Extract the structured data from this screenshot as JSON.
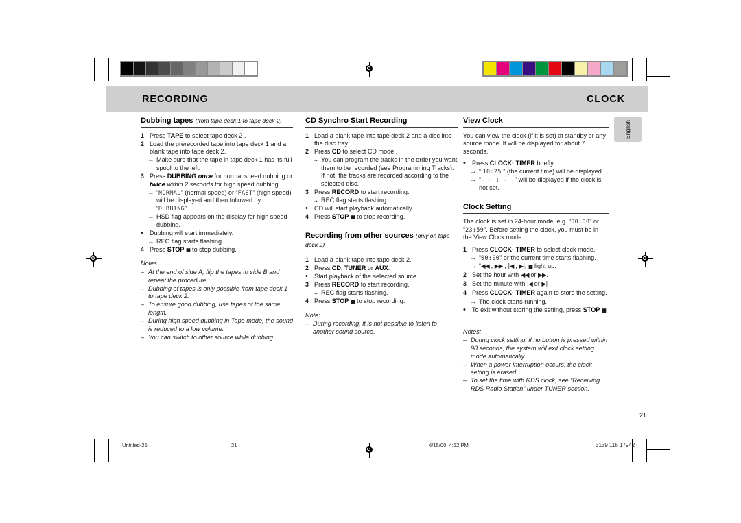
{
  "header": {
    "chapter_left": "RECORDING",
    "chapter_right": "CLOCK"
  },
  "language_tab": {
    "label": "English"
  },
  "calibration": {
    "grayscale": [
      "#000000",
      "#151515",
      "#333333",
      "#4c4c4c",
      "#666666",
      "#808080",
      "#999999",
      "#b3b3b3",
      "#cccccc",
      "#f0f0f0",
      "#ffffff"
    ],
    "color": [
      "#f5e400",
      "#e5007d",
      "#0095da",
      "#3a0f82",
      "#009640",
      "#e30613",
      "#000000",
      "#f7f0a8",
      "#f5a8c8",
      "#a8d8f0",
      "#9d9d9c"
    ]
  },
  "columns": {
    "left": {
      "section": {
        "title": "Dubbing tapes",
        "subtitle": "(from tape deck 1 to tape deck 2)"
      },
      "steps": [
        {
          "marker": "1",
          "type": "num",
          "parts": [
            {
              "t": "Press "
            },
            {
              "t": "TAPE",
              "s": "b"
            },
            {
              "t": " to select tape deck 2 ."
            }
          ]
        },
        {
          "marker": "2",
          "type": "num",
          "parts": [
            {
              "t": "Load the prerecorded tape into tape deck 1 and a blank tape into tape deck 2."
            }
          ]
        },
        {
          "marker": "→",
          "type": "arrow",
          "parts": [
            {
              "t": "Make sure that the tape in tape deck 1 has its full spool to the left."
            }
          ]
        },
        {
          "marker": "3",
          "type": "num",
          "parts": [
            {
              "t": "Press "
            },
            {
              "t": "DUBBING ",
              "s": "b"
            },
            {
              "t": "once",
              "s": "bi"
            },
            {
              "t": " for normal speed dubbing or "
            },
            {
              "t": "twice",
              "s": "bi"
            },
            {
              "t": " within 2 seconds",
              "s": "i"
            },
            {
              "t": " for high speed dubbing."
            }
          ]
        },
        {
          "marker": "→",
          "type": "arrow",
          "parts": [
            {
              "t": "“"
            },
            {
              "t": "NORMAL",
              "s": "lcd"
            },
            {
              "t": "” (normal speed) or “"
            },
            {
              "t": "FAST",
              "s": "lcd"
            },
            {
              "t": "” (high speed) will be displayed and then followed by “"
            },
            {
              "t": "DUBBING",
              "s": "lcd"
            },
            {
              "t": "”."
            }
          ]
        },
        {
          "marker": "→",
          "type": "arrow",
          "parts": [
            {
              "t": "HSD flag appears on the display for high speed dubbing."
            }
          ]
        },
        {
          "marker": "•",
          "type": "bul",
          "parts": [
            {
              "t": "Dubbing will start immediately."
            }
          ]
        },
        {
          "marker": "→",
          "type": "arrow",
          "parts": [
            {
              "t": "REC flag starts flashing."
            }
          ]
        },
        {
          "marker": "4",
          "type": "num",
          "parts": [
            {
              "t": "Press "
            },
            {
              "t": "STOP",
              "s": "b"
            },
            {
              "t": " "
            },
            {
              "t": "■",
              "s": "g-stop"
            },
            {
              "t": " to stop dubbing."
            }
          ]
        }
      ],
      "notes": {
        "title": "Notes:",
        "items": [
          "At the end of side A, flip the tapes to side B and repeat the procedure.",
          "Dubbing of tapes is only possible from tape deck 1 to tape deck 2.",
          "To ensure good dubbing, use tapes of the same length.",
          "During high speed dubbing in Tape mode, the sound is reduced to a low volume.",
          "You can switch to other source while dubbing."
        ]
      }
    },
    "middle": {
      "section1": {
        "title": "CD Synchro Start Recording",
        "subtitle": ""
      },
      "steps1": [
        {
          "marker": "1",
          "type": "num",
          "parts": [
            {
              "t": "Load a blank tape into tape deck 2 and a disc into the disc tray."
            }
          ]
        },
        {
          "marker": "2",
          "type": "num",
          "parts": [
            {
              "t": "Press "
            },
            {
              "t": "CD",
              "s": "b"
            },
            {
              "t": " to select CD mode ."
            }
          ]
        },
        {
          "marker": "→",
          "type": "arrow",
          "parts": [
            {
              "t": "You can program the tracks in the order you want them to be recorded (see Programming Tracks).  If not, the tracks are recorded according to the selected disc."
            }
          ]
        },
        {
          "marker": "3",
          "type": "num",
          "parts": [
            {
              "t": "Press "
            },
            {
              "t": "RECORD",
              "s": "b"
            },
            {
              "t": " to start recording."
            }
          ]
        },
        {
          "marker": "→",
          "type": "arrow",
          "parts": [
            {
              "t": "REC flag starts flashing."
            }
          ]
        },
        {
          "marker": "•",
          "type": "bul",
          "parts": [
            {
              "t": "CD will start playback automatically."
            }
          ]
        },
        {
          "marker": "4",
          "type": "num",
          "parts": [
            {
              "t": "Press "
            },
            {
              "t": "STOP",
              "s": "b"
            },
            {
              "t": " "
            },
            {
              "t": "■",
              "s": "g-stop"
            },
            {
              "t": " to stop recording."
            }
          ]
        }
      ],
      "section2": {
        "title": "Recording from other sources",
        "subtitle": "(only on tape deck 2)"
      },
      "steps2": [
        {
          "marker": "1",
          "type": "num",
          "parts": [
            {
              "t": "Load a blank tape into tape deck 2."
            }
          ]
        },
        {
          "marker": "2",
          "type": "num",
          "parts": [
            {
              "t": "Press "
            },
            {
              "t": "CD",
              "s": "b"
            },
            {
              "t": ", "
            },
            {
              "t": "TUNER",
              "s": "b"
            },
            {
              "t": " or "
            },
            {
              "t": "AUX",
              "s": "b"
            },
            {
              "t": "."
            }
          ]
        },
        {
          "marker": "•",
          "type": "bul",
          "parts": [
            {
              "t": "Start playback of the selected source."
            }
          ]
        },
        {
          "marker": "3",
          "type": "num",
          "parts": [
            {
              "t": "Press "
            },
            {
              "t": "RECORD",
              "s": "b"
            },
            {
              "t": " to start recording."
            }
          ]
        },
        {
          "marker": "→",
          "type": "arrow",
          "parts": [
            {
              "t": "REC flag starts flashing."
            }
          ]
        },
        {
          "marker": "4",
          "type": "num",
          "parts": [
            {
              "t": "Press "
            },
            {
              "t": "STOP",
              "s": "b"
            },
            {
              "t": " "
            },
            {
              "t": "■",
              "s": "g-stop"
            },
            {
              "t": " to stop recording."
            }
          ]
        }
      ],
      "note": {
        "title": "Note:",
        "items": [
          "During recording, it is not possible to listen to another sound source."
        ]
      }
    },
    "right": {
      "section1": {
        "title": "View Clock",
        "subtitle": ""
      },
      "intro1": "You can view the clock (if it is set) at standby or any source mode. It will be displayed for about 7 seconds.",
      "steps1": [
        {
          "marker": "•",
          "type": "bul",
          "parts": [
            {
              "t": "Press "
            },
            {
              "t": "CLOCK· TIMER",
              "s": "b"
            },
            {
              "t": " briefly."
            }
          ]
        },
        {
          "marker": "→",
          "type": "arrow",
          "parts": [
            {
              "t": "“ "
            },
            {
              "t": "10:25",
              "s": "lcd"
            },
            {
              "t": " ” (the current time) will be displayed."
            }
          ]
        },
        {
          "marker": "→",
          "type": "arrow",
          "parts": [
            {
              "t": "“"
            },
            {
              "t": "- - : - -",
              "s": "lcd"
            },
            {
              "t": "” will be displayed if the clock is not set."
            }
          ]
        }
      ],
      "section2": {
        "title": "Clock Setting",
        "subtitle": ""
      },
      "intro2_parts": [
        {
          "t": "The clock is set in 24-hour mode, e.g. “"
        },
        {
          "t": "00:00",
          "s": "lcd"
        },
        {
          "t": "” or “"
        },
        {
          "t": "23:59",
          "s": "lcd"
        },
        {
          "t": "”. Before setting the clock, you must be in the View Clock mode."
        }
      ],
      "steps2": [
        {
          "marker": "1",
          "type": "num",
          "parts": [
            {
              "t": "Press "
            },
            {
              "t": "CLOCK· TIMER",
              "s": "b"
            },
            {
              "t": " to select clock mode."
            }
          ]
        },
        {
          "marker": "→",
          "type": "arrow",
          "parts": [
            {
              "t": "“"
            },
            {
              "t": "00:00",
              "s": "lcd"
            },
            {
              "t": "” or the current time starts flashing."
            }
          ]
        },
        {
          "marker": "→",
          "type": "arrow",
          "parts": [
            {
              "t": "“"
            },
            {
              "t": "◀◀",
              "s": "g"
            },
            {
              "t": " , "
            },
            {
              "t": "▶▶",
              "s": "g"
            },
            {
              "t": " , "
            },
            {
              "t": "|◀",
              "s": "g"
            },
            {
              "t": " , "
            },
            {
              "t": "▶|",
              "s": "g"
            },
            {
              "t": ",    "
            },
            {
              "t": "■",
              "s": "g-stop"
            },
            {
              "t": " light up."
            }
          ]
        },
        {
          "marker": "2",
          "type": "num",
          "parts": [
            {
              "t": "Set the hour with "
            },
            {
              "t": "◀◀",
              "s": "g"
            },
            {
              "t": " or "
            },
            {
              "t": "▶▶",
              "s": "g"
            },
            {
              "t": "."
            }
          ]
        },
        {
          "marker": "3",
          "type": "num",
          "parts": [
            {
              "t": "Set the minute with "
            },
            {
              "t": "|◀",
              "s": "g"
            },
            {
              "t": " or "
            },
            {
              "t": "▶|",
              "s": "g"
            },
            {
              "t": " ."
            }
          ]
        },
        {
          "marker": "4",
          "type": "num",
          "parts": [
            {
              "t": "Press "
            },
            {
              "t": "CLOCK· TIMER",
              "s": "b"
            },
            {
              "t": " again to store the setting."
            }
          ]
        },
        {
          "marker": "→",
          "type": "arrow",
          "parts": [
            {
              "t": "The clock starts running."
            }
          ]
        },
        {
          "marker": "•",
          "type": "bul",
          "parts": [
            {
              "t": "To exit without storing the setting, press "
            },
            {
              "t": "STOP",
              "s": "b"
            },
            {
              "t": " "
            },
            {
              "t": "■",
              "s": "g-stop"
            },
            {
              "t": " ."
            }
          ]
        }
      ],
      "notes": {
        "title": "Notes:",
        "items": [
          "During clock setting,  if no button is pressed within 90 seconds, the system will exit clock setting mode automatically.",
          "When a power interruption occurs, the clock setting is erased.",
          "To set the time with RDS clock, see “Receiving RDS Radio Station” under TUNER section."
        ]
      }
    }
  },
  "folio": {
    "page_number": "21"
  },
  "scan_footer": {
    "file": "Untitled-26",
    "page": "21",
    "date": "6/15/00, 4:52 PM",
    "code": "3139 116 17942"
  }
}
